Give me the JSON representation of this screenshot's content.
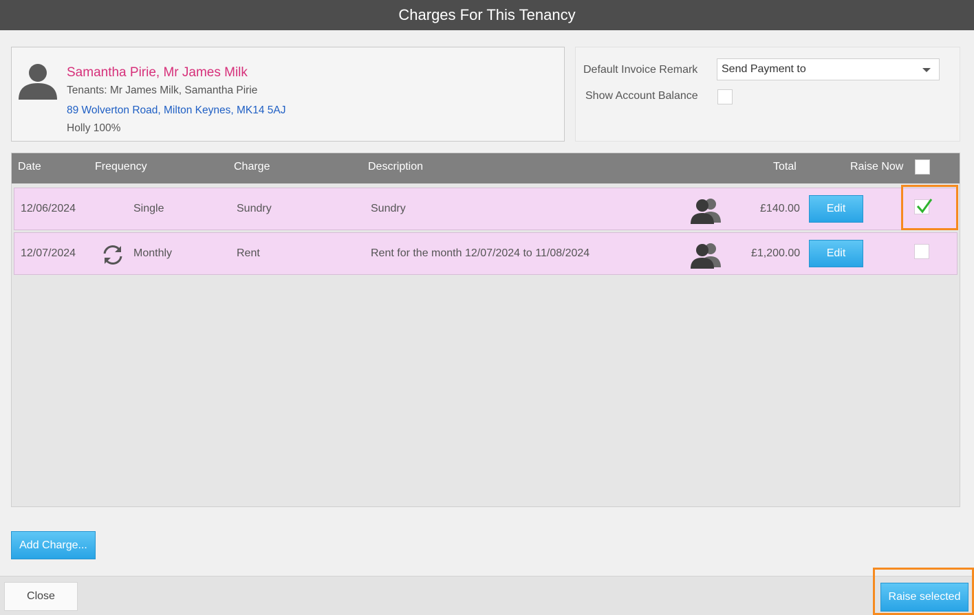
{
  "window": {
    "title": "Charges For This Tenancy"
  },
  "tenant": {
    "name": "Samantha Pirie, Mr James Milk",
    "tenants": "Tenants: Mr James Milk, Samantha Pirie",
    "address": "89 Wolverton Road, Milton Keynes, MK14 5AJ",
    "owner": "Holly 100%"
  },
  "settings": {
    "invoice_remark_label": "Default Invoice Remark",
    "invoice_remark_value": "Send Payment to",
    "show_balance_label": "Show Account Balance",
    "show_balance_checked": false
  },
  "grid": {
    "headers": {
      "date": "Date",
      "frequency": "Frequency",
      "charge": "Charge",
      "description": "Description",
      "total": "Total",
      "raise_now": "Raise Now"
    },
    "rows": [
      {
        "date": "12/06/2024",
        "frequency": "Single",
        "recurring": false,
        "charge": "Sundry",
        "description": "Sundry",
        "total": "£140.00",
        "edit_label": "Edit",
        "raise_now": true
      },
      {
        "date": "12/07/2024",
        "frequency": "Monthly",
        "recurring": true,
        "charge": "Rent",
        "description": "Rent for the month 12/07/2024 to 11/08/2024",
        "total": "£1,200.00",
        "edit_label": "Edit",
        "raise_now": false
      }
    ]
  },
  "actions": {
    "add_charge": "Add Charge...",
    "close": "Close",
    "raise_selected": "Raise selected"
  },
  "colors": {
    "title_bar": "#4d4d4d",
    "tenant_name": "#d6307a",
    "address_link": "#1f5fc4",
    "row_background": "#f4d7f4",
    "button_blue": "#29a4e6",
    "highlight": "#f68a1f",
    "check_green": "#2db32d"
  },
  "icons": {
    "avatar": "person-silhouette-icon",
    "tenants": "people-icon",
    "recurring": "repeat-icon",
    "checked": "checkmark-icon",
    "dropdown": "chevron-down-icon"
  }
}
